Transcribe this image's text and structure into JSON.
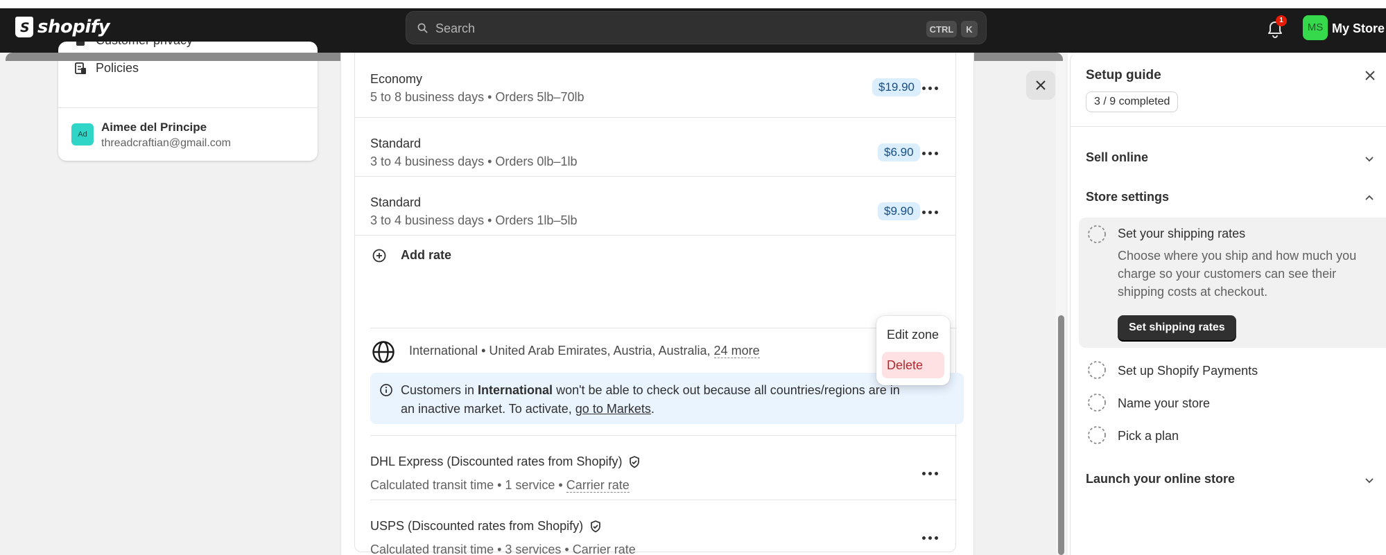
{
  "topbar": {
    "logo_text": "shopify",
    "search_placeholder": "Search",
    "shortcut_ctrl": "CTRL",
    "shortcut_k": "K",
    "notification_count": "1",
    "avatar_initials": "MS",
    "store_name": "My Store"
  },
  "left_card": {
    "nav_privacy": "Customer privacy",
    "nav_policies": "Policies",
    "user_initials": "Ad",
    "user_name": "Aimee del Principe",
    "user_email": "threadcraftian@gmail.com"
  },
  "rates": [
    {
      "name": "Economy",
      "detail": "5 to 8 business days • Orders 5lb–70lb",
      "price": "$19.90"
    },
    {
      "name": "Standard",
      "detail": "3 to 4 business days • Orders 0lb–1lb",
      "price": "$6.90"
    },
    {
      "name": "Standard",
      "detail": "3 to 4 business days • Orders 1lb–5lb",
      "price": "$9.90"
    }
  ],
  "add_rate_label": "Add rate",
  "zone": {
    "prefix": "International • United Arab Emirates, Austria, Australia,",
    "more": "24 more",
    "banner_pre": "Customers in ",
    "banner_bold": "International",
    "banner_mid": " won't be able to check out because all countries/regions are in an inactive market. To activate, ",
    "banner_link": "go to Markets",
    "banner_end": "."
  },
  "popover": {
    "edit": "Edit zone",
    "delete": "Delete"
  },
  "carriers": [
    {
      "name": "DHL Express (Discounted rates from Shopify)",
      "detail": "Calculated transit time • 1 service •",
      "link": "Carrier rate"
    },
    {
      "name": "USPS (Discounted rates from Shopify)",
      "detail": "Calculated transit time • 3 services •",
      "link": "Carrier rate"
    }
  ],
  "setup_guide": {
    "title": "Setup guide",
    "progress": "3 / 9 completed",
    "sections": {
      "sell_online": "Sell online",
      "store_settings": "Store settings",
      "launch": "Launch your online store"
    },
    "tasks": {
      "shipping_title": "Set your shipping rates",
      "shipping_desc": "Choose where you ship and how much you charge so your customers can see their shipping costs at checkout.",
      "shipping_button": "Set shipping rates",
      "payments": "Set up Shopify Payments",
      "name_store": "Name your store",
      "plan": "Pick a plan"
    }
  },
  "colors": {
    "topbar": "#1a1a1a",
    "badge_bg": "#dbeefd",
    "delete_bg": "#fde1e3",
    "brand_green": "#36d84c"
  }
}
